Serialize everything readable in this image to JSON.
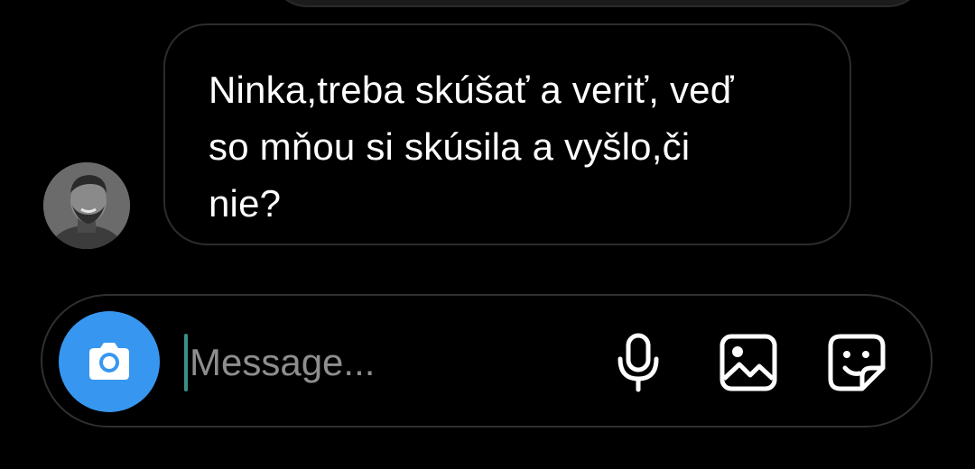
{
  "thread": {
    "message": {
      "text": "Ninka,treba skúšať a veriť, veď\nso mňou si skúsila a vyšlo,či\nnie?",
      "sender_avatar": "avatar-icon"
    }
  },
  "composer": {
    "placeholder": "Message...",
    "value": "",
    "camera_icon": "camera-icon",
    "mic_icon": "microphone-icon",
    "gallery_icon": "image-gallery-icon",
    "sticker_icon": "sticker-icon"
  },
  "colors": {
    "background": "#000000",
    "accent": "#3797f0",
    "border": "#2c2c2c",
    "placeholder": "#8e8e8e",
    "caret": "#3a8f89"
  }
}
